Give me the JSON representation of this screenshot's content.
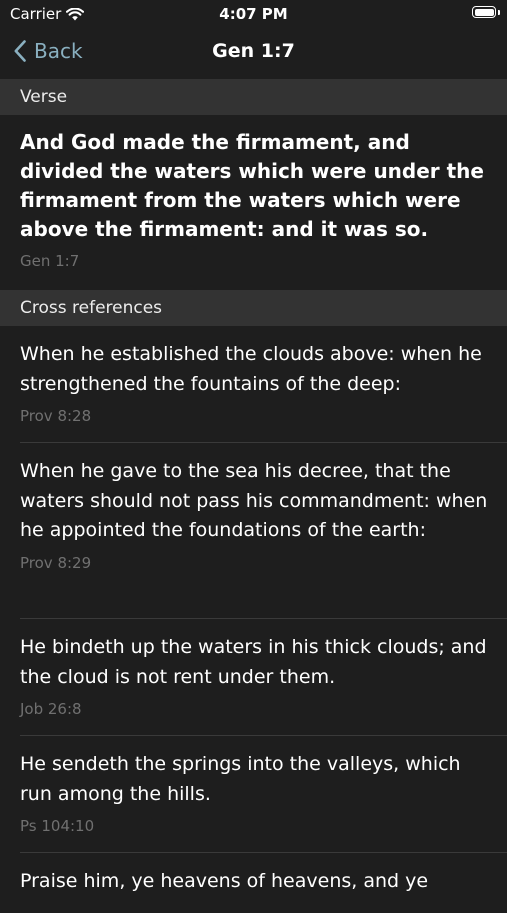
{
  "status_bar": {
    "carrier": "Carrier",
    "time": "4:07 PM"
  },
  "nav": {
    "back_label": "Back",
    "title": "Gen 1:7"
  },
  "verse_section": {
    "header": "Verse",
    "text": "And God made the firmament, and divided the waters which were under the firmament from the waters which were above the firmament: and it was so.",
    "reference": "Gen 1:7"
  },
  "cross_references": {
    "header": "Cross references",
    "items": [
      {
        "text": "When he established the clouds above: when he strengthened the fountains of the deep:",
        "reference": "Prov 8:28"
      },
      {
        "text": "When he gave to the sea his decree, that the waters should not pass his commandment: when he appointed the foundations of the earth:",
        "reference": "Prov 8:29"
      },
      {
        "text": "He bindeth up the waters in his thick clouds; and the cloud is not rent under them.",
        "reference": "Job 26:8"
      },
      {
        "text": "He sendeth the springs into the valleys, which run among the hills.",
        "reference": "Ps 104:10"
      },
      {
        "text": "Praise him, ye heavens of heavens, and ye",
        "reference": ""
      }
    ]
  },
  "colors": {
    "background": "#1e1e1e",
    "section_header_bg": "#333333",
    "accent": "#8ab0c0",
    "reference_text": "#707070"
  },
  "icons": {
    "wifi": "wifi-icon",
    "battery": "battery-icon",
    "back": "chevron-left-icon"
  }
}
